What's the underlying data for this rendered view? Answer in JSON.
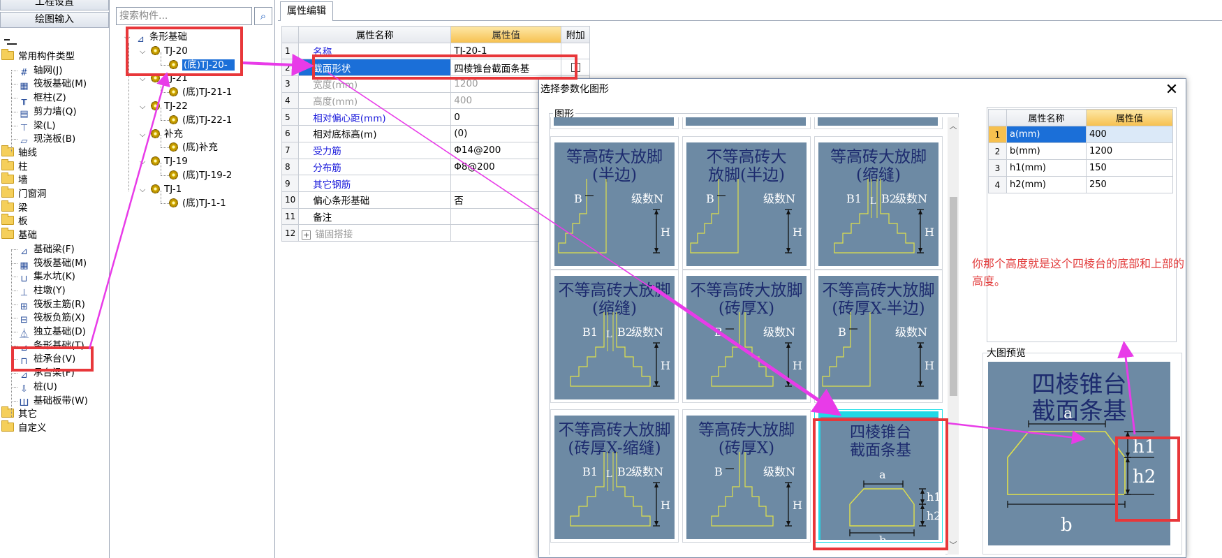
{
  "nav": {
    "btn_project": "工程设置",
    "btn_draw": "绘图输入",
    "items": [
      {
        "type": "folder",
        "label": "常用构件类型",
        "indent": 0
      },
      {
        "type": "item",
        "label": "轴网(J)",
        "icon": "grid-icon"
      },
      {
        "type": "item",
        "label": "筏板基础(M)",
        "icon": "raft-foundation-icon"
      },
      {
        "type": "item",
        "label": "框柱(Z)",
        "icon": "column-icon"
      },
      {
        "type": "item",
        "label": "剪力墙(Q)",
        "icon": "shear-wall-icon"
      },
      {
        "type": "item",
        "label": "梁(L)",
        "icon": "beam-icon"
      },
      {
        "type": "item",
        "label": "现浇板(B)",
        "icon": "slab-icon"
      },
      {
        "type": "folder",
        "label": "轴线"
      },
      {
        "type": "folder",
        "label": "柱"
      },
      {
        "type": "folder",
        "label": "墙"
      },
      {
        "type": "folder",
        "label": "门窗洞"
      },
      {
        "type": "folder",
        "label": "梁"
      },
      {
        "type": "folder",
        "label": "板"
      },
      {
        "type": "folder",
        "label": "基础"
      },
      {
        "type": "item",
        "label": "基础梁(F)",
        "icon": "foundation-beam-icon"
      },
      {
        "type": "item",
        "label": "筏板基础(M)",
        "icon": "raft-foundation-icon"
      },
      {
        "type": "item",
        "label": "集水坑(K)",
        "icon": "sump-pit-icon"
      },
      {
        "type": "item",
        "label": "柱墩(Y)",
        "icon": "column-pier-icon"
      },
      {
        "type": "item",
        "label": "筏板主筋(R)",
        "icon": "raft-main-rebar-icon"
      },
      {
        "type": "item",
        "label": "筏板负筋(X)",
        "icon": "raft-negative-rebar-icon"
      },
      {
        "type": "item",
        "label": "独立基础(D)",
        "icon": "isolated-foundation-icon"
      },
      {
        "type": "item",
        "label": "条形基础(T)",
        "icon": "strip-foundation-icon"
      },
      {
        "type": "item",
        "label": "桩承台(V)",
        "icon": "pile-cap-icon"
      },
      {
        "type": "item",
        "label": "承台梁(F)",
        "icon": "cap-beam-icon"
      },
      {
        "type": "item",
        "label": "桩(U)",
        "icon": "pile-icon"
      },
      {
        "type": "item",
        "label": "基础板带(W)",
        "icon": "foundation-strip-icon"
      },
      {
        "type": "folder",
        "label": "其它"
      },
      {
        "type": "folder",
        "label": "自定义"
      }
    ]
  },
  "search": {
    "placeholder": "搜索构件..."
  },
  "comp_tree": [
    {
      "level": 0,
      "label": "条形基础",
      "kind": "root"
    },
    {
      "level": 1,
      "label": "TJ-20",
      "kind": "group"
    },
    {
      "level": 2,
      "label": "(底)TJ-20-",
      "kind": "leaf",
      "selected": true
    },
    {
      "level": 1,
      "label": "TJ-21",
      "kind": "group"
    },
    {
      "level": 2,
      "label": "(底)TJ-21-1",
      "kind": "leaf"
    },
    {
      "level": 1,
      "label": "TJ-22",
      "kind": "group"
    },
    {
      "level": 2,
      "label": "(底)TJ-22-1",
      "kind": "leaf"
    },
    {
      "level": 1,
      "label": "补充",
      "kind": "group"
    },
    {
      "level": 2,
      "label": "(底)补充",
      "kind": "leaf"
    },
    {
      "level": 1,
      "label": "TJ-19",
      "kind": "group"
    },
    {
      "level": 2,
      "label": "(底)TJ-19-2",
      "kind": "leaf"
    },
    {
      "level": 1,
      "label": "TJ-1",
      "kind": "group"
    },
    {
      "level": 2,
      "label": "(底)TJ-1-1",
      "kind": "leaf"
    }
  ],
  "prop_tab": "属性编辑",
  "prop_table": {
    "headers": [
      "属性名称",
      "属性值",
      "附加"
    ],
    "rows": [
      {
        "n": "1",
        "name": "名称",
        "value": "TJ-20-1",
        "style": "blue"
      },
      {
        "n": "2",
        "name": "截面形状",
        "value": "四棱锥台截面条基",
        "style": "sel",
        "check": true
      },
      {
        "n": "3",
        "name": "宽度(mm)",
        "value": "1200",
        "style": "gray"
      },
      {
        "n": "4",
        "name": "高度(mm)",
        "value": "400",
        "style": "gray"
      },
      {
        "n": "5",
        "name": "相对偏心距(mm)",
        "value": "0",
        "style": "blue"
      },
      {
        "n": "6",
        "name": "相对底标高(m)",
        "value": "(0)",
        "style": ""
      },
      {
        "n": "7",
        "name": "受力筋",
        "value": "Φ14@200",
        "style": "blue"
      },
      {
        "n": "8",
        "name": "分布筋",
        "value": "Φ8@200",
        "style": "blue"
      },
      {
        "n": "9",
        "name": "其它钢筋",
        "value": "",
        "style": "blue"
      },
      {
        "n": "10",
        "name": "偏心条形基础",
        "value": "否",
        "style": ""
      },
      {
        "n": "11",
        "name": "备注",
        "value": "",
        "style": ""
      },
      {
        "n": "12",
        "name": "锚固搭接",
        "value": "",
        "style": "gray",
        "expand": "+"
      }
    ]
  },
  "dialog": {
    "title": "选择参数化图形",
    "close": "✕",
    "group_label": "图形",
    "tiles": [
      {
        "title": "等高砖大放脚\n(半边)",
        "kind": "half",
        "labels": {
          "b": "B",
          "n": "级数N",
          "h": "H"
        }
      },
      {
        "title": "不等高砖大\n放脚(半边)",
        "kind": "half",
        "labels": {
          "b": "B",
          "n": "级数N",
          "h": "H"
        }
      },
      {
        "title": "等高砖大放脚\n(缩缝)",
        "kind": "joint",
        "labels": {
          "b1": "B1",
          "l": "L",
          "b2": "B2",
          "n": "级数N",
          "h": "H"
        }
      },
      {
        "title": "不等高砖大放脚\n(缩缝)",
        "kind": "joint",
        "labels": {
          "b1": "B1",
          "l": "L",
          "b2": "B2",
          "n": "级数N",
          "h": "H"
        }
      },
      {
        "title": "不等高砖大放脚\n(砖厚X)",
        "kind": "full",
        "labels": {
          "b": "B",
          "n": "级数N",
          "h": "H"
        }
      },
      {
        "title": "不等高砖大放脚\n(砖厚X-半边)",
        "kind": "half",
        "labels": {
          "b": "B",
          "n": "级数N",
          "h": "H"
        }
      },
      {
        "title": "不等高砖大放脚\n(砖厚X-缩缝)",
        "kind": "joint",
        "labels": {
          "b1": "B1",
          "l": "L",
          "b2": "B2",
          "n": "级数N",
          "h": "H"
        }
      },
      {
        "title": "等高砖大放脚\n(砖厚X)",
        "kind": "full",
        "labels": {
          "b": "B",
          "n": "级数N",
          "h": "H"
        }
      },
      {
        "title": "四棱锥台\n截面条基",
        "kind": "frustum",
        "selected": true,
        "labels": {
          "a": "a",
          "h1": "h1",
          "h2": "h2",
          "b": "b"
        }
      }
    ],
    "param_table": {
      "headers": [
        "属性名称",
        "属性值"
      ],
      "rows": [
        {
          "n": "1",
          "name": "a(mm)",
          "value": "400",
          "selected": true
        },
        {
          "n": "2",
          "name": "b(mm)",
          "value": "1200"
        },
        {
          "n": "3",
          "name": "h1(mm)",
          "value": "150"
        },
        {
          "n": "4",
          "name": "h2(mm)",
          "value": "250"
        }
      ]
    },
    "note": "你那个高度就是这个四棱台的底部和上部的高度。",
    "preview_label": "大图预览",
    "preview": {
      "title": "四棱锥台\n截面条基",
      "a": "a",
      "h1": "h1",
      "h2": "h2",
      "b": "b"
    }
  },
  "colors": {
    "annotation_red": "#e8373a",
    "arrow_magenta": "#e83be8",
    "tile_bg": "#6d8aa4",
    "select_blue": "#1b6fd8"
  }
}
